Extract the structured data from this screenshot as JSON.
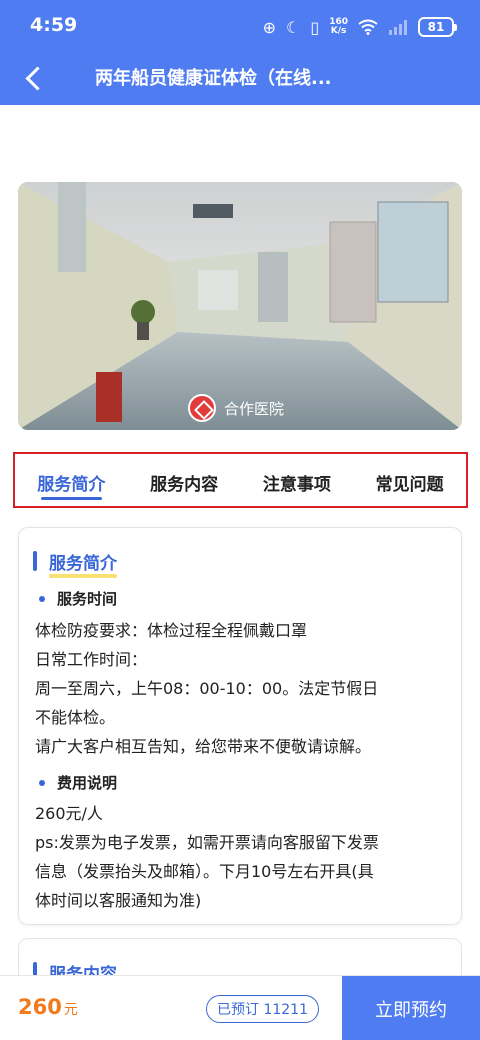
{
  "status": {
    "time": "4:59",
    "net_speed_top": "160",
    "net_speed_bottom": "K/s",
    "battery": "81"
  },
  "nav": {
    "title": "两年船员健康证体检（在线..."
  },
  "banner": {
    "partner_label": "合作医院"
  },
  "tabs": [
    {
      "label": "服务简介",
      "active": true
    },
    {
      "label": "服务内容",
      "active": false
    },
    {
      "label": "注意事项",
      "active": false
    },
    {
      "label": "常见问题",
      "active": false
    }
  ],
  "intro": {
    "title": "服务简介",
    "time_heading": "服务时间",
    "time_lines": [
      "体检防疫要求：体检过程全程佩戴口罩",
      "日常工作时间：",
      "周一至周六，上午08：00-10：00。法定节假日",
      "不能体检。",
      "请广大客户相互告知，给您带来不便敬请谅解。"
    ],
    "fee_heading": "费用说明",
    "fee_lines": [
      "260元/人",
      "ps:发票为电子发票，如需开票请向客服留下发票",
      "信息（发票抬头及邮箱）。下月10号左右开具(具",
      "体时间以客服通知为准)"
    ]
  },
  "content_section": {
    "title": "服务内容"
  },
  "footer": {
    "price": "260",
    "price_unit": "元",
    "booked": "已预订 11211",
    "book_button": "立即预约"
  },
  "colors": {
    "brand": "#4f7cf0",
    "accent": "#3a67d8",
    "price": "#f07a1c",
    "highlight": "#d81f26"
  }
}
